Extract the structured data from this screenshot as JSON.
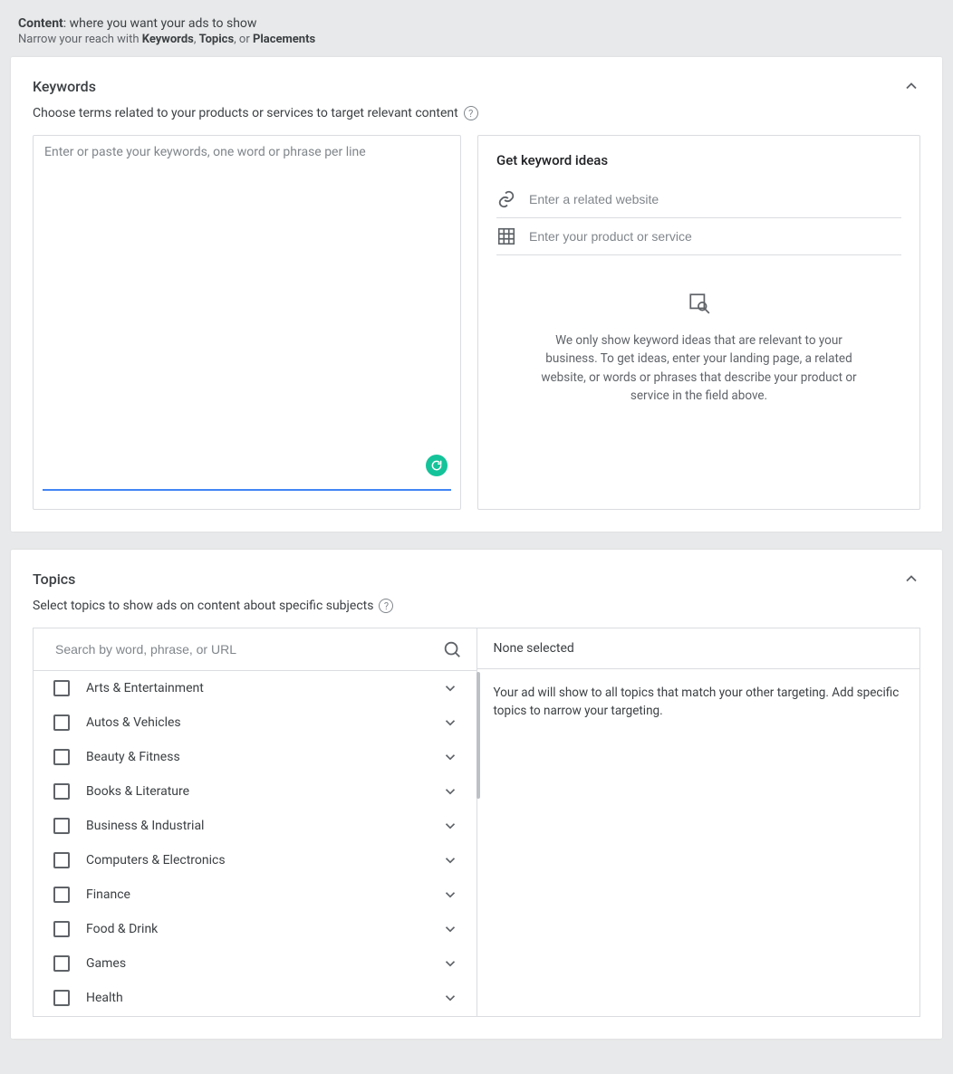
{
  "header": {
    "line1_bold": "Content",
    "line1_rest": ": where you want your ads to show",
    "line2_prefix": "Narrow your reach with ",
    "line2_k": "Keywords",
    "line2_sep1": ", ",
    "line2_t": "Topics",
    "line2_sep2": ", or ",
    "line2_p": "Placements"
  },
  "keywords": {
    "title": "Keywords",
    "subtitle": "Choose terms related to your products or services to target relevant content",
    "textarea_placeholder": "Enter or paste your keywords, one word or phrase per line",
    "ideas_title": "Get keyword ideas",
    "website_placeholder": "Enter a related website",
    "product_placeholder": "Enter your product or service",
    "empty_message": "We only show keyword ideas that are relevant to your business. To get ideas, enter your landing page, a related website, or words or phrases that describe your product or service in the field above."
  },
  "topics": {
    "title": "Topics",
    "subtitle": "Select topics to show ads on content about specific subjects",
    "search_placeholder": "Search by word, phrase, or URL",
    "none_selected": "None selected",
    "none_body": "Your ad will show to all topics that match your other targeting. Add specific topics to narrow your targeting.",
    "items": [
      {
        "label": "Arts & Entertainment"
      },
      {
        "label": "Autos & Vehicles"
      },
      {
        "label": "Beauty & Fitness"
      },
      {
        "label": "Books & Literature"
      },
      {
        "label": "Business & Industrial"
      },
      {
        "label": "Computers & Electronics"
      },
      {
        "label": "Finance"
      },
      {
        "label": "Food & Drink"
      },
      {
        "label": "Games"
      },
      {
        "label": "Health"
      }
    ]
  }
}
